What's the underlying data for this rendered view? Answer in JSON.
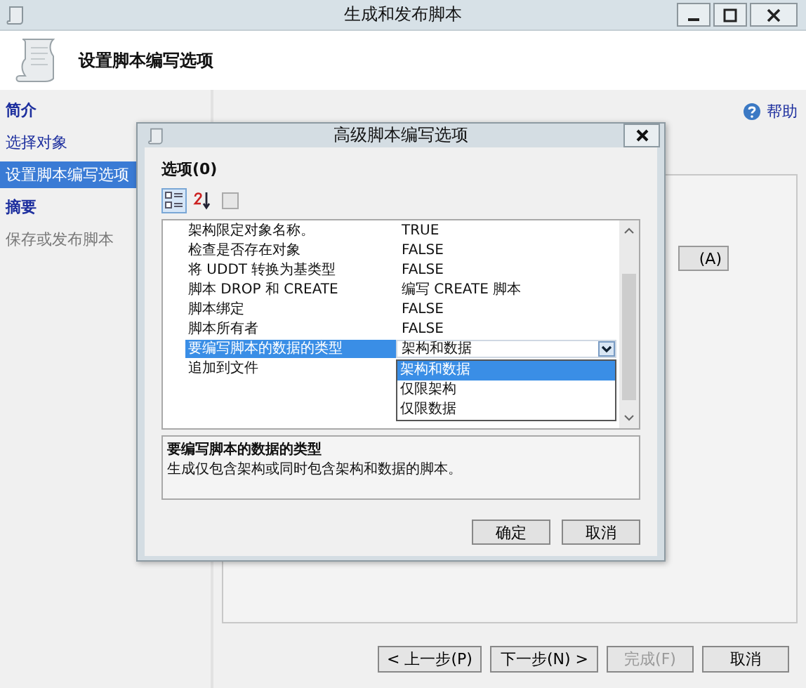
{
  "window": {
    "title": "生成和发布脚本"
  },
  "header": {
    "title": "设置脚本编写选项"
  },
  "sidebar": {
    "items": [
      {
        "label": "简介",
        "kind": "section",
        "selected": false,
        "disabled": false
      },
      {
        "label": "选择对象",
        "kind": "step",
        "selected": false,
        "disabled": false
      },
      {
        "label": "设置脚本编写选项",
        "kind": "step",
        "selected": true,
        "disabled": false
      },
      {
        "label": "摘要",
        "kind": "section",
        "selected": false,
        "disabled": false
      },
      {
        "label": "保存或发布脚本",
        "kind": "step",
        "selected": false,
        "disabled": true
      }
    ]
  },
  "help": {
    "label": "帮助"
  },
  "background_button": {
    "label": "(A)"
  },
  "dialog": {
    "title": "高级脚本编写选项",
    "options_label": "选项(0)",
    "toolbar": [
      {
        "kind": "categorized",
        "selected": true
      },
      {
        "kind": "alphabetical",
        "selected": false
      },
      {
        "kind": "pages",
        "selected": false
      }
    ],
    "rows": [
      {
        "name": "架构限定对象名称。",
        "value": "TRUE",
        "selected": false
      },
      {
        "name": "检查是否存在对象",
        "value": "FALSE",
        "selected": false
      },
      {
        "name": "将 UDDT 转换为基类型",
        "value": "FALSE",
        "selected": false
      },
      {
        "name": "脚本 DROP 和 CREATE",
        "value": "编写 CREATE 脚本",
        "selected": false
      },
      {
        "name": "脚本绑定",
        "value": "FALSE",
        "selected": false
      },
      {
        "name": "脚本所有者",
        "value": "FALSE",
        "selected": false
      },
      {
        "name": "要编写脚本的数据的类型",
        "value": "架构和数据",
        "selected": true,
        "dropdown": [
          {
            "label": "架构和数据",
            "selected": true
          },
          {
            "label": "仅限架构",
            "selected": false
          },
          {
            "label": "仅限数据",
            "selected": false
          }
        ]
      },
      {
        "name": "追加到文件",
        "selected": false
      }
    ],
    "description": {
      "title": "要编写脚本的数据的类型",
      "text": "生成仅包含架构或同时包含架构和数据的脚本。"
    },
    "buttons": [
      "确定",
      "取消"
    ]
  },
  "wizard_buttons": [
    {
      "label": "< 上一步(P)",
      "disabled": false
    },
    {
      "label": "下一步(N) >",
      "disabled": false
    },
    {
      "label": "完成(F)",
      "disabled": true
    },
    {
      "label": "取消",
      "disabled": false
    }
  ]
}
